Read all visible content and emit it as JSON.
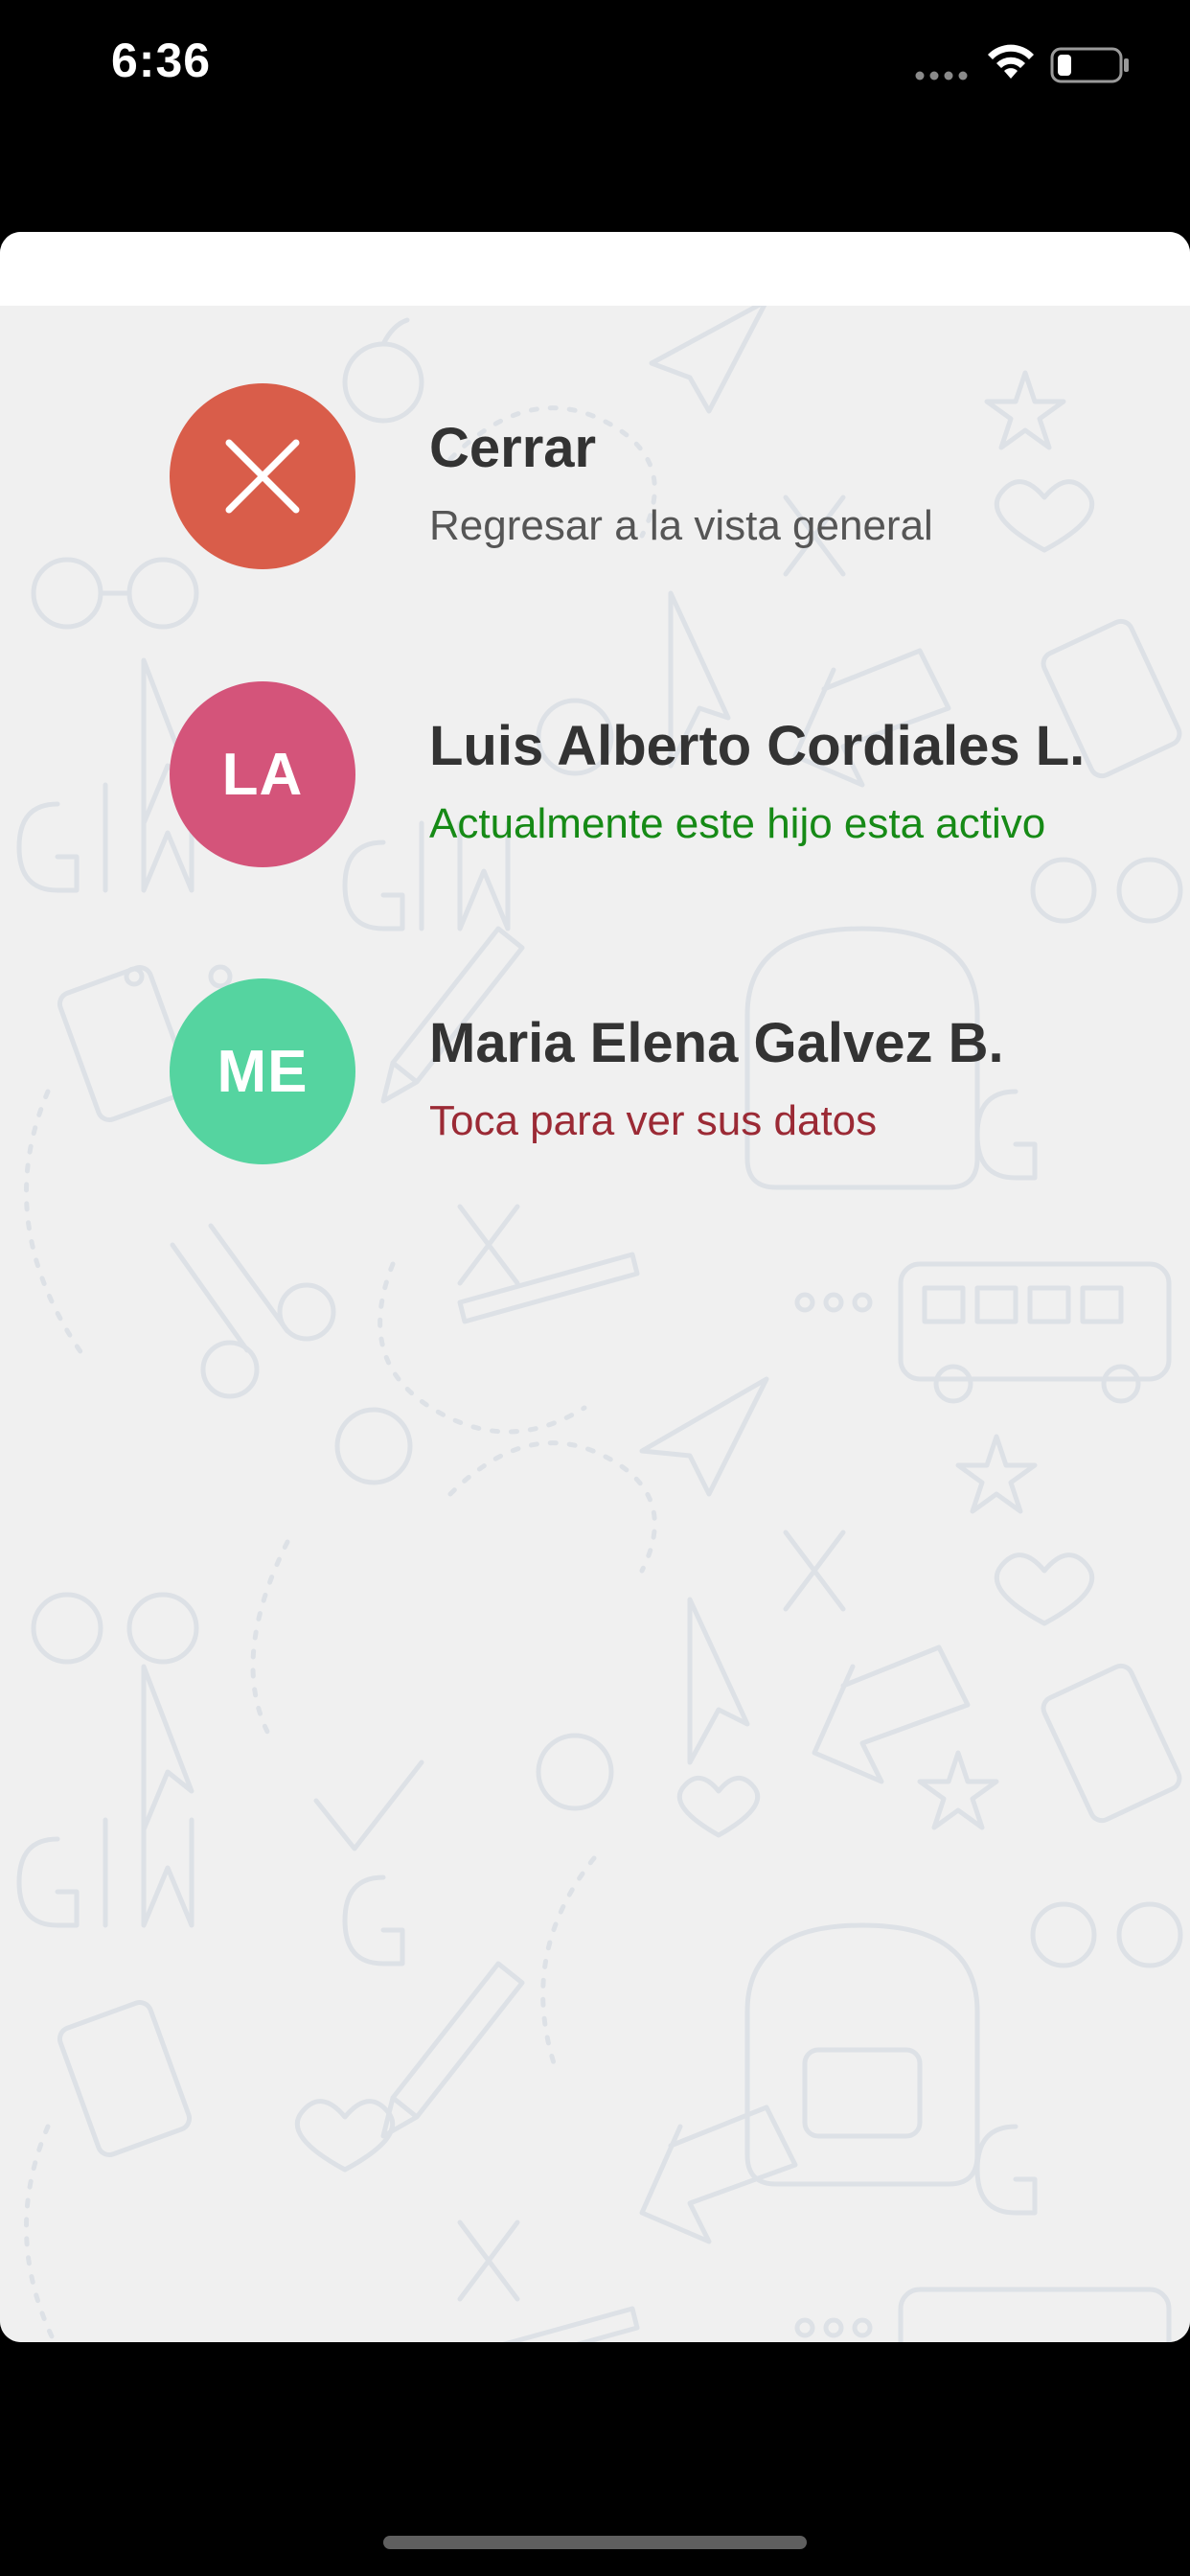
{
  "status_bar": {
    "time": "6:36",
    "icons": [
      "signal-dots-icon",
      "wifi-icon",
      "battery-icon"
    ]
  },
  "colors": {
    "close_avatar": "#D95D4A",
    "child1_avatar": "#D4547A",
    "child2_avatar": "#55D4A0",
    "active_status": "#168A16",
    "inactive_status": "#9B2A35",
    "title_text": "#333333",
    "subtitle_text": "#555555"
  },
  "menu": {
    "close": {
      "icon": "close-icon",
      "title": "Cerrar",
      "subtitle": "Regresar a la vista general"
    },
    "children": [
      {
        "initials": "LA",
        "name": "Luis Alberto Cordiales L.",
        "status": "Actualmente este hijo esta activo"
      },
      {
        "initials": "ME",
        "name": "Maria Elena Galvez B.",
        "status": "Toca para ver sus datos"
      }
    ]
  }
}
